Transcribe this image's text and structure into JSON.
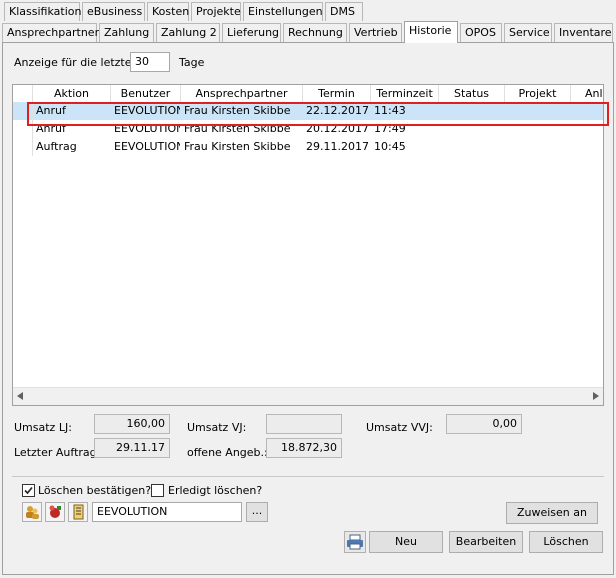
{
  "tabs_row1": [
    "Klassifikation",
    "eBusiness",
    "Kosten",
    "Projekte",
    "Einstellungen",
    "DMS"
  ],
  "tabs_row2": [
    "Ansprechpartner",
    "Zahlung",
    "Zahlung 2",
    "Lieferung",
    "Rechnung",
    "Vertrieb",
    "Historie",
    "OPOS",
    "Service",
    "Inventare"
  ],
  "active_tab": "Historie",
  "filter": {
    "label": "Anzeige für die letzten",
    "value": "30",
    "unit": "Tage"
  },
  "grid": {
    "columns": [
      "Aktion",
      "Benutzer",
      "Ansprechpartner",
      "Termin",
      "Terminzeit",
      "Status",
      "Projekt",
      "Anla"
    ],
    "rows": [
      [
        "Anruf",
        "EEVOLUTION",
        "Frau Kirsten Skibbe",
        "22.12.2017",
        "11:43",
        "",
        "",
        ""
      ],
      [
        "Anruf",
        "EEVOLUTION",
        "Frau Kirsten Skibbe",
        "20.12.2017",
        "17:49",
        "",
        "",
        ""
      ],
      [
        "Auftrag",
        "EEVOLUTION",
        "Frau Kirsten Skibbe",
        "29.11.2017",
        "10:45",
        "",
        "",
        ""
      ]
    ],
    "selected_row": 0
  },
  "summary": {
    "umsatz_lj_label": "Umsatz LJ:",
    "umsatz_lj": "160,00",
    "umsatz_vj_label": "Umsatz VJ:",
    "umsatz_vj": "",
    "umsatz_vvj_label": "Umsatz VVJ:",
    "umsatz_vvj": "0,00",
    "letzter_auftrag_label": "Letzter Auftrag:",
    "letzter_auftrag": "29.11.17",
    "offene_angeb_label": "offene Angeb.:",
    "offene_angeb": "18.872,30"
  },
  "options": {
    "loeschen_bestaetigen": "Löschen bestätigen?",
    "loeschen_bestaetigen_checked": true,
    "erledigt_loeschen": "Erledigt löschen?",
    "erledigt_loeschen_checked": false
  },
  "user_field": {
    "value": "EEVOLUTION",
    "browse": "..."
  },
  "buttons": {
    "zuweisen": "Zuweisen an",
    "neu": "Neu",
    "bearbeiten": "Bearbeiten",
    "loeschen": "Löschen"
  },
  "colors": {
    "highlight": "#e02020",
    "selection": "#cce4f7"
  }
}
